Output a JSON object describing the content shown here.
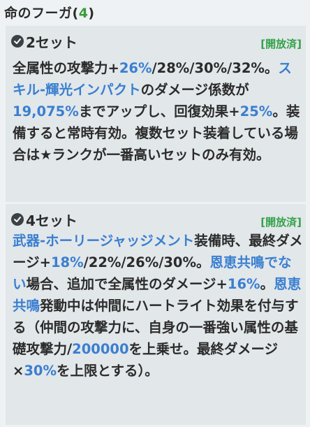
{
  "title": {
    "text": "命のフーガ(",
    "count": "4",
    "close": ")"
  },
  "sets": [
    {
      "name": "2セット",
      "status": "[開放済]",
      "desc": [
        {
          "t": "全属性の攻撃力+",
          "c": "n"
        },
        {
          "t": "26%",
          "c": "h"
        },
        {
          "t": "/28%/30%/32%。",
          "c": "n"
        },
        {
          "t": "スキル-輝光インパクト",
          "c": "h"
        },
        {
          "t": "のダメージ係数が",
          "c": "n"
        },
        {
          "t": "19,075%",
          "c": "h"
        },
        {
          "t": "までアップし、回復効果+",
          "c": "n"
        },
        {
          "t": "25%",
          "c": "h"
        },
        {
          "t": "。装備すると常時有効。複数セット装着している場合は★ランクが一番高いセットのみ有効。",
          "c": "n"
        }
      ]
    },
    {
      "name": "4セット",
      "status": "[開放済]",
      "desc": [
        {
          "t": "武器-ホーリージャッジメント",
          "c": "h"
        },
        {
          "t": "装備時、最終ダメージ+",
          "c": "n"
        },
        {
          "t": "18%",
          "c": "h"
        },
        {
          "t": "/22%/26%/30%。",
          "c": "n"
        },
        {
          "t": "恩恵共鳴でない",
          "c": "h"
        },
        {
          "t": "場合、追加で全属性のダメージ+",
          "c": "n"
        },
        {
          "t": "16%",
          "c": "h"
        },
        {
          "t": "。",
          "c": "n"
        },
        {
          "t": "恩恵共鳴",
          "c": "h"
        },
        {
          "t": "発動中は仲間にハートライト効果を付与する（仲間の攻撃力に、自身の一番強い属性の基礎攻撃力/",
          "c": "n"
        },
        {
          "t": "200000",
          "c": "h"
        },
        {
          "t": "を上乗せ。最終ダメージ×",
          "c": "n"
        },
        {
          "t": "30%",
          "c": "h"
        },
        {
          "t": "を上限とする）。",
          "c": "n"
        }
      ]
    }
  ]
}
